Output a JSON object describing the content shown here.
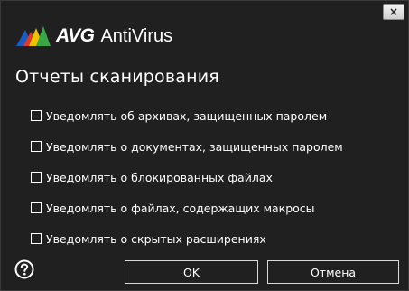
{
  "window": {
    "close_glyph": "×"
  },
  "brand": {
    "name": "AVG",
    "product": "AntiVirus"
  },
  "dialog": {
    "title": "Отчеты сканирования",
    "options": [
      {
        "label": "Уведомлять об архивах, защищенных паролем",
        "checked": false
      },
      {
        "label": "Уведомлять о документах, защищенных паролем",
        "checked": false
      },
      {
        "label": "Уведомлять о блокированных файлах",
        "checked": false
      },
      {
        "label": "Уведомлять о файлах, содержащих макросы",
        "checked": false
      },
      {
        "label": "Уведомлять о скрытых расширениях",
        "checked": false
      }
    ]
  },
  "buttons": {
    "ok": "OK",
    "cancel": "Отмена"
  },
  "icons": {
    "help": "help-icon",
    "close": "close-icon",
    "logo": "avg-logo-icon"
  },
  "colors": {
    "background": "#202020",
    "text": "#ffffff",
    "logo_blue": "#1d5cbf",
    "logo_red": "#e03a2f",
    "logo_yellow": "#f2c200",
    "logo_green": "#3aa645"
  }
}
